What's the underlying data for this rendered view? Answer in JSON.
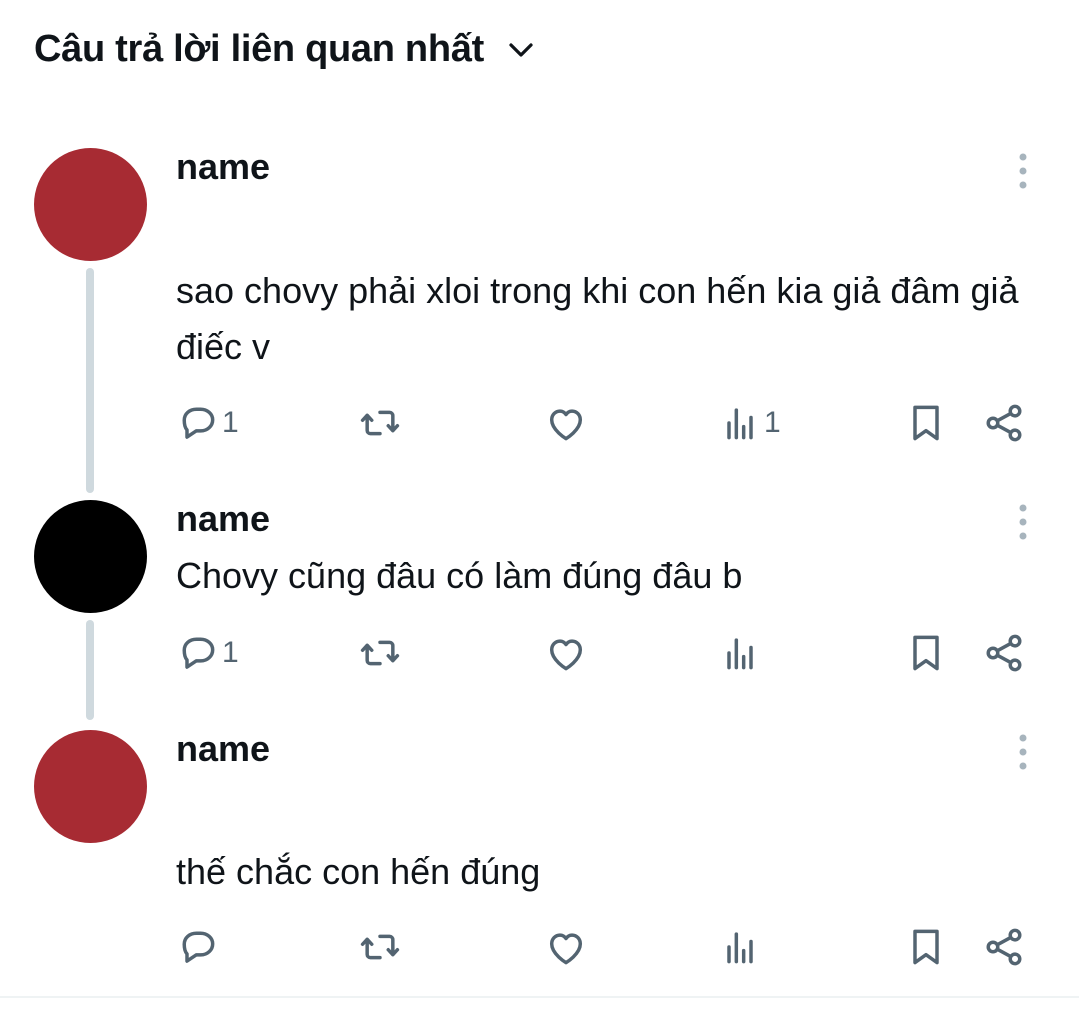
{
  "header": {
    "sort_label": "Câu trả lời liên quan nhất",
    "chevron_icon": "chevron-down-icon"
  },
  "colors": {
    "avatar_red": "#a72b33",
    "avatar_black": "#000000",
    "thread_line": "#cfd9de",
    "icon_gray": "#536471",
    "text": "#0f1419"
  },
  "replies": [
    {
      "username": "name",
      "avatar_color": "#a72b33",
      "text": "sao chovy phải xloi trong khi con hến kia giả đâm giả điếc v",
      "reply_count": "1",
      "retweet_count": "",
      "like_count": "",
      "view_count": "1"
    },
    {
      "username": "name",
      "avatar_color": "#000000",
      "text": "Chovy cũng đâu có làm đúng đâu b",
      "reply_count": "1",
      "retweet_count": "",
      "like_count": "",
      "view_count": ""
    },
    {
      "username": "name",
      "avatar_color": "#a72b33",
      "text": "thế chắc con hến đúng",
      "reply_count": "",
      "retweet_count": "",
      "like_count": "",
      "view_count": ""
    }
  ],
  "icons": [
    "reply-icon",
    "retweet-icon",
    "like-icon",
    "views-icon",
    "bookmark-icon",
    "share-icon",
    "more-icon"
  ]
}
